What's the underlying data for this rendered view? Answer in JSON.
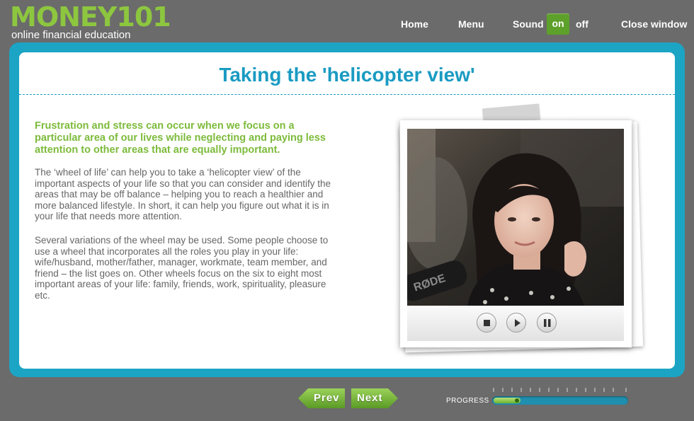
{
  "header": {
    "logo_text": "MONEY101",
    "tagline": "online financial education",
    "nav": {
      "home": "Home",
      "menu": "Menu",
      "sound": "Sound",
      "sound_on": "on",
      "sound_off": "off",
      "close": "Close window"
    }
  },
  "content": {
    "title": "Taking the 'helicopter view'",
    "lead": "Frustration and stress can occur when we focus on a particular area of our lives while neglecting and paying less attention to other areas that are equally important.",
    "paragraphs": [
      "The ‘wheel of life’ can help you to take a ‘helicopter view’ of the important aspects of your life so that you can consider and identify the areas that may be off balance – helping you to reach a healthier and more balanced lifestyle. In short, it can help you figure out what it is in your life that needs more attention.",
      "Several variations of the wheel may be used. Some people choose to use a wheel that incorporates all the roles you play in your life: wife/husband, mother/father, manager, workmate, team member, and friend – the list goes on. Other wheels focus on the six to eight most important areas of your life: family, friends, work, spirituality, pleasure etc."
    ],
    "video": {
      "mic_text": "RØDE",
      "controls": [
        "stop-icon",
        "play-icon",
        "pause-icon"
      ]
    }
  },
  "footer": {
    "prev": "Prev",
    "next": "Next",
    "progress_label": "PROGRESS",
    "progress_fraction": 0.2
  },
  "colors": {
    "brand_green": "#8dc63f",
    "accent_blue": "#1ca4c4",
    "title_blue": "#1a9bc2",
    "lead_green": "#7dbb3b",
    "background": "#6b6b6b"
  }
}
